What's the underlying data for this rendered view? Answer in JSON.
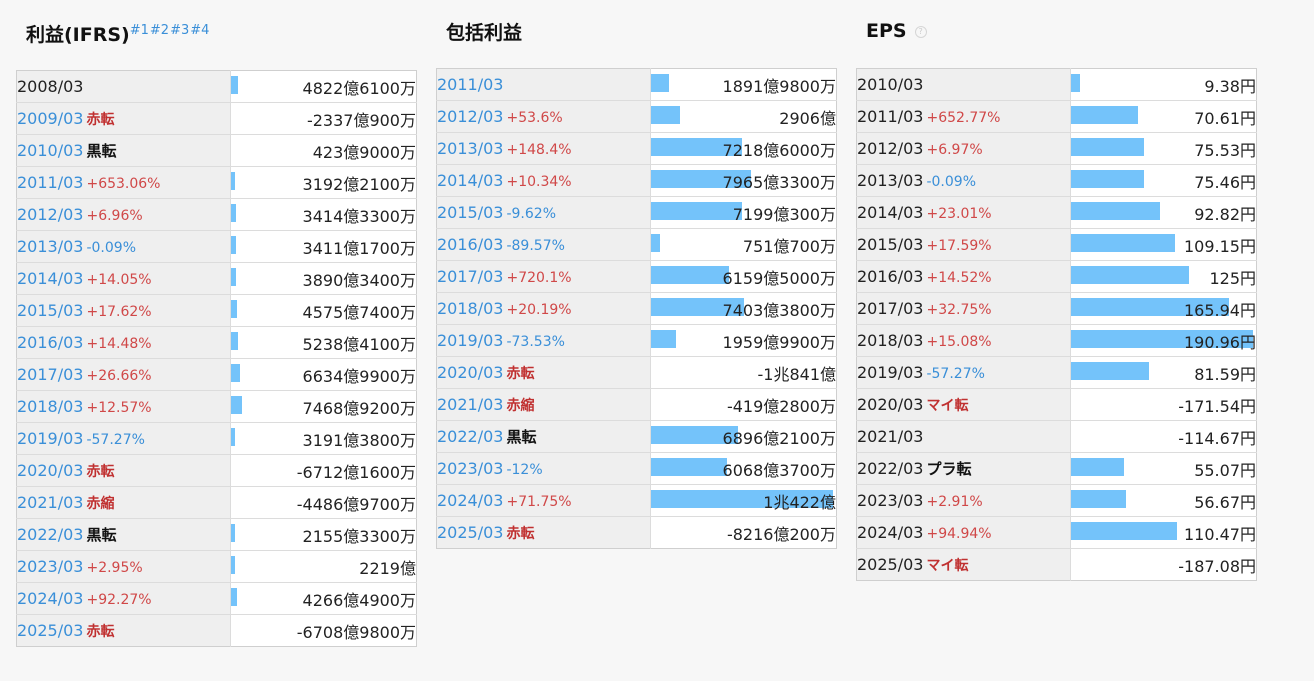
{
  "sections": [
    {
      "title": "利益(IFRS)",
      "footnotes": [
        "#1",
        "#2",
        "#3",
        "#4"
      ],
      "rows": [
        {
          "year": "2008/03",
          "change": "",
          "value": "4822億6100万",
          "bar": 0.48
        },
        {
          "year": "2009/03",
          "change": "赤転",
          "value": "-2337億900万",
          "bar": 0
        },
        {
          "year": "2010/03",
          "change": "黒転",
          "value": "423億9000万",
          "bar": 0
        },
        {
          "year": "2011/03",
          "change": "+653.06%",
          "value": "3192億2100万",
          "bar": 0.32
        },
        {
          "year": "2012/03",
          "change": "+6.96%",
          "value": "3414億3300万",
          "bar": 0.34
        },
        {
          "year": "2013/03",
          "change": "-0.09%",
          "value": "3411億1700万",
          "bar": 0.34
        },
        {
          "year": "2014/03",
          "change": "+14.05%",
          "value": "3890億3400万",
          "bar": 0.39
        },
        {
          "year": "2015/03",
          "change": "+17.62%",
          "value": "4575億7400万",
          "bar": 0.46
        },
        {
          "year": "2016/03",
          "change": "+14.48%",
          "value": "5238億4100万",
          "bar": 0.52
        },
        {
          "year": "2017/03",
          "change": "+26.66%",
          "value": "6634億9900万",
          "bar": 0.66
        },
        {
          "year": "2018/03",
          "change": "+12.57%",
          "value": "7468億9200万",
          "bar": 0.75
        },
        {
          "year": "2019/03",
          "change": "-57.27%",
          "value": "3191億3800万",
          "bar": 0.32
        },
        {
          "year": "2020/03",
          "change": "赤転",
          "value": "-6712億1600万",
          "bar": 0
        },
        {
          "year": "2021/03",
          "change": "赤縮",
          "value": "-4486億9700万",
          "bar": 0
        },
        {
          "year": "2022/03",
          "change": "黒転",
          "value": "2155億3300万",
          "bar": 0.22
        },
        {
          "year": "2023/03",
          "change": "+2.95%",
          "value": "2219億",
          "bar": 0.22
        },
        {
          "year": "2024/03",
          "change": "+92.27%",
          "value": "4266億4900万",
          "bar": 0.43
        },
        {
          "year": "2025/03",
          "change": "赤転",
          "value": "-6708億9800万",
          "bar": 0
        }
      ]
    },
    {
      "title": "包括利益",
      "footnotes": [],
      "rows": [
        {
          "year": "2011/03",
          "change": "",
          "value": "1891億9800万",
          "bar": 0.1
        },
        {
          "year": "2012/03",
          "change": "+53.6%",
          "value": "2906億",
          "bar": 0.16
        },
        {
          "year": "2013/03",
          "change": "+148.4%",
          "value": "7218億6000万",
          "bar": 0.5
        },
        {
          "year": "2014/03",
          "change": "+10.34%",
          "value": "7965億3300万",
          "bar": 0.55
        },
        {
          "year": "2015/03",
          "change": "-9.62%",
          "value": "7199億300万",
          "bar": 0.5
        },
        {
          "year": "2016/03",
          "change": "-89.57%",
          "value": "751億700万",
          "bar": 0.05
        },
        {
          "year": "2017/03",
          "change": "+720.1%",
          "value": "6159億5000万",
          "bar": 0.43
        },
        {
          "year": "2018/03",
          "change": "+20.19%",
          "value": "7403億3800万",
          "bar": 0.51
        },
        {
          "year": "2019/03",
          "change": "-73.53%",
          "value": "1959億9900万",
          "bar": 0.14
        },
        {
          "year": "2020/03",
          "change": "赤転",
          "value": "-1兆841億",
          "bar": 0
        },
        {
          "year": "2021/03",
          "change": "赤縮",
          "value": "-419億2800万",
          "bar": 0
        },
        {
          "year": "2022/03",
          "change": "黒転",
          "value": "6896億2100万",
          "bar": 0.48
        },
        {
          "year": "2023/03",
          "change": "-12%",
          "value": "6068億3700万",
          "bar": 0.42
        },
        {
          "year": "2024/03",
          "change": "+71.75%",
          "value": "1兆422億",
          "bar": 1.0
        },
        {
          "year": "2025/03",
          "change": "赤転",
          "value": "-8216億200万",
          "bar": 0
        }
      ]
    },
    {
      "title": "EPS",
      "footnotes": [],
      "rows": [
        {
          "year": "2010/03",
          "change": "",
          "value": "9.38円",
          "bar": 0.05
        },
        {
          "year": "2011/03",
          "change": "+652.77%",
          "value": "70.61円",
          "bar": 0.37
        },
        {
          "year": "2012/03",
          "change": "+6.97%",
          "value": "75.53円",
          "bar": 0.4
        },
        {
          "year": "2013/03",
          "change": "-0.09%",
          "value": "75.46円",
          "bar": 0.4
        },
        {
          "year": "2014/03",
          "change": "+23.01%",
          "value": "92.82円",
          "bar": 0.49
        },
        {
          "year": "2015/03",
          "change": "+17.59%",
          "value": "109.15円",
          "bar": 0.57
        },
        {
          "year": "2016/03",
          "change": "+14.52%",
          "value": "125円",
          "bar": 0.65
        },
        {
          "year": "2017/03",
          "change": "+32.75%",
          "value": "165.94円",
          "bar": 0.87
        },
        {
          "year": "2018/03",
          "change": "+15.08%",
          "value": "190.96円",
          "bar": 1.0
        },
        {
          "year": "2019/03",
          "change": "-57.27%",
          "value": "81.59円",
          "bar": 0.43
        },
        {
          "year": "2020/03",
          "change": "マイ転",
          "value": "-171.54円",
          "bar": 0
        },
        {
          "year": "2021/03",
          "change": "",
          "value": "-114.67円",
          "bar": 0
        },
        {
          "year": "2022/03",
          "change": "プラ転",
          "value": "55.07円",
          "bar": 0.29
        },
        {
          "year": "2023/03",
          "change": "+2.91%",
          "value": "56.67円",
          "bar": 0.3
        },
        {
          "year": "2024/03",
          "change": "+94.94%",
          "value": "110.47円",
          "bar": 0.58
        },
        {
          "year": "2025/03",
          "change": "マイ転",
          "value": "-187.08円",
          "bar": 0
        }
      ]
    }
  ],
  "colors": {
    "bar": "#74c3fa",
    "link": "#3a8fd8",
    "positive": "#d04848",
    "negative": "#3a8fd8",
    "turn_red": "#c03030"
  }
}
